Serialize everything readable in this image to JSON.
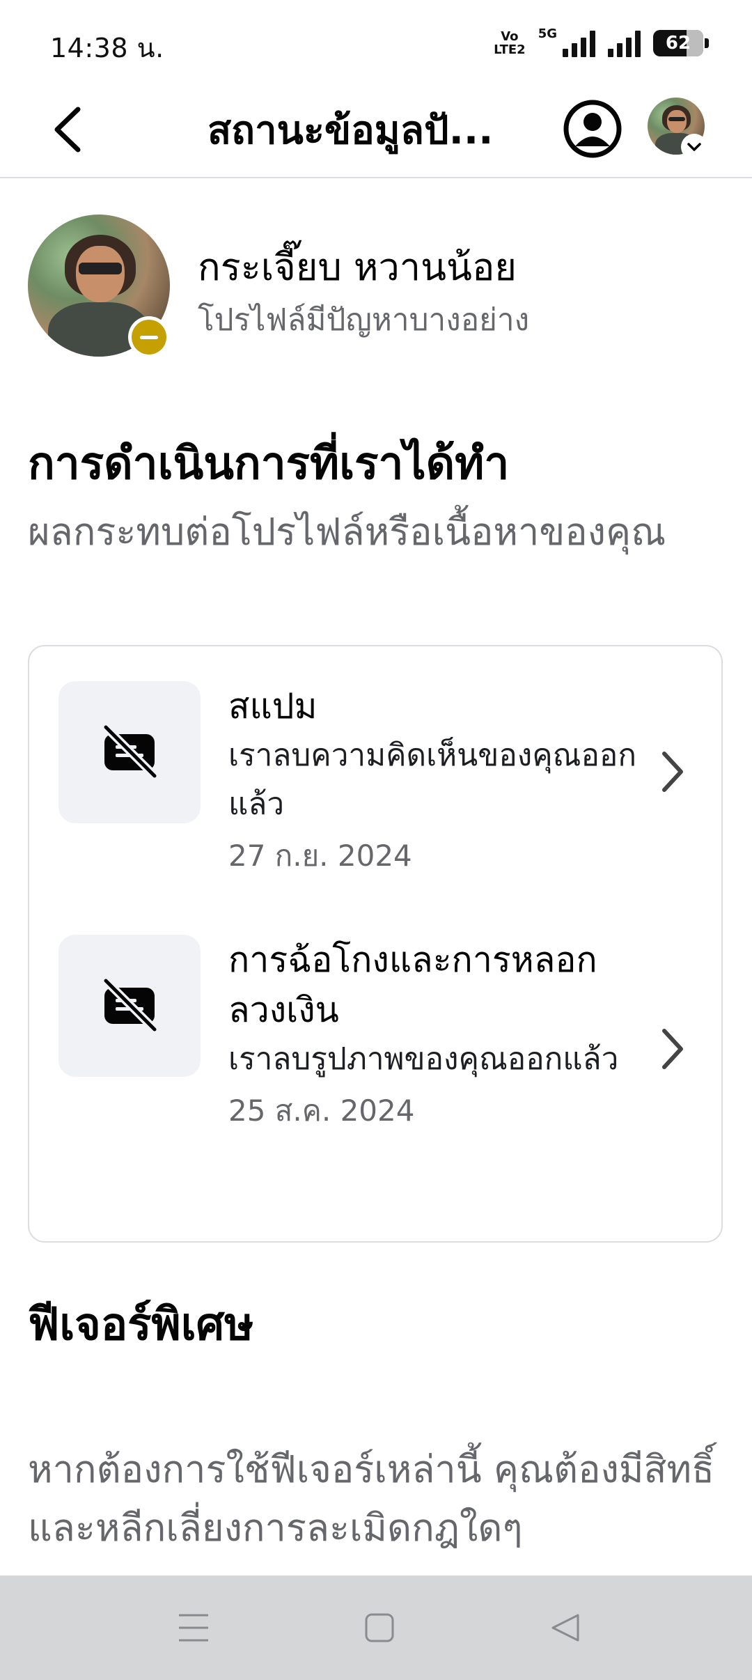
{
  "status_bar": {
    "time": "14:38 น.",
    "volte_line1": "Vo",
    "volte_line2": "LTE2",
    "network": "5G",
    "battery": "62"
  },
  "header": {
    "title": "สถานะข้อมูลปั...",
    "back_icon": "chevron-left-icon",
    "account_icon": "account-circle-icon"
  },
  "profile": {
    "name": "กระเจี๊ยบ หวานน้อย",
    "status": "โปรไฟล์มีปัญหาบางอย่าง",
    "status_color": "#c4a000"
  },
  "actions_section": {
    "title": "การดำเนินการที่เราได้ทำ",
    "subtitle": "ผลกระทบต่อโปรไฟล์หรือเนื้อหาของคุณ",
    "items": [
      {
        "icon": "comment-removed-icon",
        "title": "สแปม",
        "description": "เราลบความคิดเห็นของคุณออกแล้ว",
        "date": "27 ก.ย. 2024"
      },
      {
        "icon": "comment-removed-icon",
        "title": "การฉ้อโกงและการหลอกลวงเงิน",
        "description": "เราลบรูปภาพของคุณออกแล้ว",
        "date": "25 ส.ค. 2024"
      }
    ]
  },
  "features_section": {
    "title": "ฟีเจอร์พิเศษ",
    "description": "หากต้องการใช้ฟีเจอร์เหล่านี้ คุณต้องมีสิทธิ์และหลีกเลี่ยงการละเมิดกฎใดๆ"
  },
  "nav_bar": {
    "recents_icon": "menu-icon",
    "home_icon": "square-icon",
    "back_icon": "triangle-back-icon"
  }
}
